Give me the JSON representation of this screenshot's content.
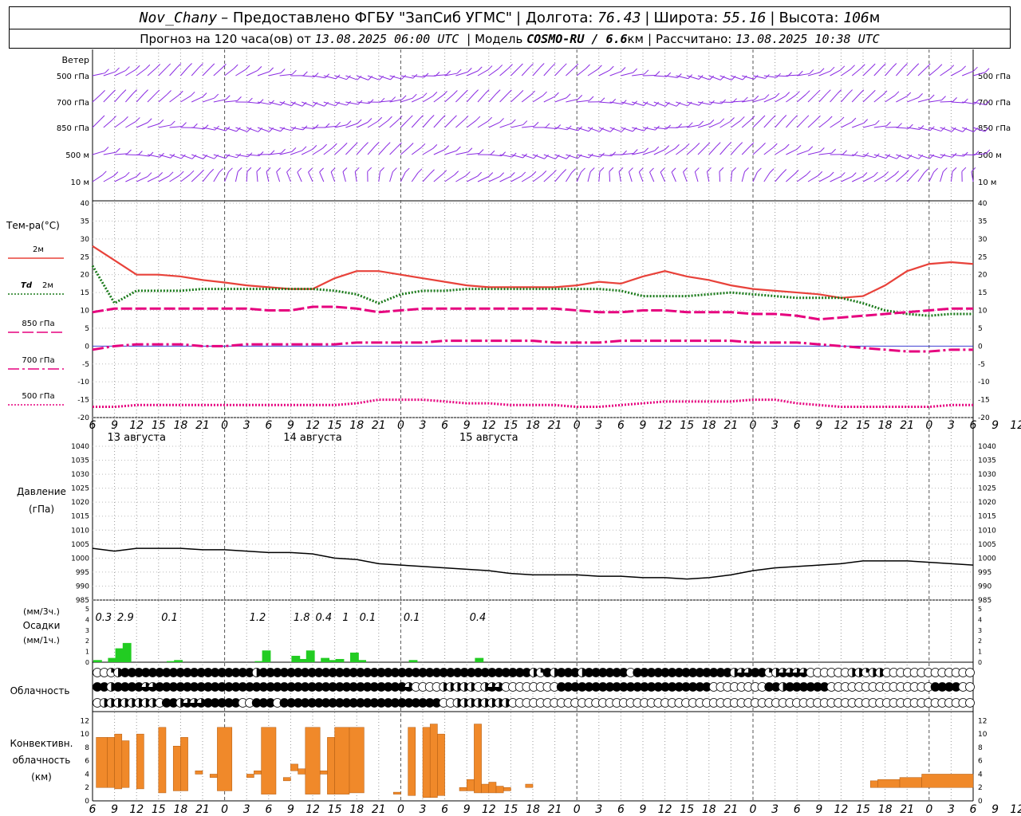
{
  "header": {
    "line1": {
      "station": "Nov_Chany",
      "provider": "– Предоставлено ФГБУ \"ЗапСиб УГМС\"",
      "lon_label": "Долгота:",
      "lon": "76.43",
      "lat_label": "Широта:",
      "lat": "55.16",
      "alt_label": "Высота:",
      "alt": "106",
      "alt_unit": "м"
    },
    "line2": {
      "forecast_label": "Прогноз на 120 часа(ов) от",
      "forecast_time": "13.08.2025 06:00 UTC",
      "model_label": "Модель",
      "model": "COSMO-RU / 6.6",
      "model_unit": "км",
      "calc_label": "Рассчитано:",
      "calc_time": "13.08.2025 10:38 UTC"
    }
  },
  "chart_data": [
    {
      "type": "wind_barbs",
      "panel_title": "Ветер",
      "levels": [
        "500 гПа",
        "700 гПа",
        "850 гПа",
        "500 м",
        "10 м"
      ],
      "color": "#8a2be2"
    },
    {
      "type": "line",
      "panel_title": "Тем-ра(°C)",
      "x_hours": [
        0,
        3,
        6,
        9,
        12,
        15,
        18,
        21,
        24,
        27,
        30,
        33,
        36,
        39,
        42,
        45,
        48,
        51,
        54,
        57,
        60,
        63,
        66,
        69,
        72,
        75,
        78,
        81,
        84,
        87,
        90,
        93,
        96,
        99,
        102,
        105,
        108,
        111,
        114,
        117,
        120
      ],
      "ylim": [
        -20,
        40
      ],
      "yticks": [
        -20,
        -15,
        -10,
        -5,
        0,
        5,
        10,
        15,
        20,
        25,
        30,
        35,
        40
      ],
      "series": [
        {
          "name": "2м",
          "color": "#e8423a",
          "style": "solid",
          "values": [
            28,
            24,
            20,
            20,
            19.5,
            18.5,
            17.8,
            17,
            16.5,
            16,
            16,
            19,
            21,
            21,
            20,
            19,
            18,
            17,
            16.5,
            16.5,
            16.5,
            16.5,
            17,
            18,
            17.5,
            19.5,
            21,
            19.5,
            18.5,
            17,
            16,
            15.5,
            15,
            14.5,
            13.5,
            14,
            17,
            21,
            23,
            23.5,
            23
          ]
        },
        {
          "name": "Td  2м",
          "color": "#1a7a1a",
          "style": "dotted",
          "values": [
            22.5,
            12,
            15.5,
            15.5,
            15.5,
            16,
            16,
            16,
            16,
            16,
            16,
            15.5,
            14.5,
            12,
            14.5,
            15.5,
            15.5,
            16,
            16,
            16,
            16,
            16,
            16,
            16,
            15.5,
            14,
            14,
            14,
            14.5,
            15,
            14.5,
            14,
            13.5,
            13.5,
            13.5,
            12,
            10,
            9,
            8.5,
            9,
            9
          ]
        },
        {
          "name": "850 гПа",
          "color": "#e6007e",
          "style": "dashed",
          "values": [
            9.5,
            10.5,
            10.5,
            10.5,
            10.5,
            10.5,
            10.5,
            10.5,
            10,
            10,
            11,
            11,
            10.5,
            9.5,
            10,
            10.5,
            10.5,
            10.5,
            10.5,
            10.5,
            10.5,
            10.5,
            10,
            9.5,
            9.5,
            10,
            10,
            9.5,
            9.5,
            9.5,
            9,
            9,
            8.5,
            7.5,
            8,
            8.5,
            9,
            9.5,
            10,
            10.5,
            10.5
          ]
        },
        {
          "name": "700 гПа",
          "color": "#e6007e",
          "style": "dashdot",
          "values": [
            -1,
            0,
            0.5,
            0.5,
            0.5,
            0,
            0,
            0.5,
            0.5,
            0.5,
            0.5,
            0.5,
            1,
            1,
            1,
            1,
            1.5,
            1.5,
            1.5,
            1.5,
            1.5,
            1,
            1,
            1,
            1.5,
            1.5,
            1.5,
            1.5,
            1.5,
            1.5,
            1,
            1,
            1,
            0.5,
            0,
            -0.5,
            -1,
            -1.5,
            -1.5,
            -1,
            -1
          ]
        },
        {
          "name": "500 гПа",
          "color": "#e6007e",
          "style": "dotted",
          "values": [
            -17,
            -17,
            -16.5,
            -16.5,
            -16.5,
            -16.5,
            -16.5,
            -16.5,
            -16.5,
            -16.5,
            -16.5,
            -16.5,
            -16,
            -15,
            -15,
            -15,
            -15.5,
            -16,
            -16,
            -16.5,
            -16.5,
            -16.5,
            -17,
            -17,
            -16.5,
            -16,
            -15.5,
            -15.5,
            -15.5,
            -15.5,
            -15,
            -15,
            -16,
            -16.5,
            -17,
            -17,
            -17,
            -17,
            -17,
            -16.5,
            -16.5
          ]
        }
      ]
    },
    {
      "type": "line",
      "panel_title": "Давление",
      "panel_unit": "(гПа)",
      "color": "#000000",
      "x_hours": [
        0,
        3,
        6,
        9,
        12,
        15,
        18,
        21,
        24,
        27,
        30,
        33,
        36,
        39,
        42,
        45,
        48,
        51,
        54,
        57,
        60,
        63,
        66,
        69,
        72,
        75,
        78,
        81,
        84,
        87,
        90,
        93,
        96,
        99,
        102,
        105,
        108,
        111,
        114,
        117,
        120
      ],
      "ylim": [
        985,
        1040
      ],
      "yticks": [
        985,
        990,
        995,
        1000,
        1005,
        1010,
        1015,
        1020,
        1025,
        1030,
        1035,
        1040
      ],
      "values": [
        1003.5,
        1002.5,
        1003.5,
        1003.5,
        1003.5,
        1003,
        1003,
        1002.5,
        1002,
        1002,
        1001.5,
        1000,
        999.5,
        998,
        997.5,
        997,
        996.5,
        996,
        995.5,
        994.5,
        994,
        994,
        994,
        993.5,
        993.5,
        993,
        993,
        992.5,
        993,
        994,
        995.5,
        996.5,
        997,
        997.5,
        998,
        999,
        999,
        999,
        998.5,
        998,
        997.5
      ]
    },
    {
      "type": "bar",
      "panel_title": "Осадки",
      "panel_unit_3h": "(мм/3ч.)",
      "panel_unit_1h": "(мм/1ч.)",
      "color": "#22cc22",
      "ylim": [
        0,
        5
      ],
      "yticks": [
        0,
        1,
        2,
        3,
        4,
        5
      ],
      "hourly": [
        {
          "h": 0,
          "v": 0.2
        },
        {
          "h": 2,
          "v": 0.4
        },
        {
          "h": 3,
          "v": 1.3
        },
        {
          "h": 4,
          "v": 1.8
        },
        {
          "h": 10,
          "v": 0.1
        },
        {
          "h": 11,
          "v": 0.2
        },
        {
          "h": 22,
          "v": 0.1
        },
        {
          "h": 23,
          "v": 1.1
        },
        {
          "h": 27,
          "v": 0.6
        },
        {
          "h": 28,
          "v": 0.3
        },
        {
          "h": 29,
          "v": 1.1
        },
        {
          "h": 31,
          "v": 0.4
        },
        {
          "h": 32,
          "v": 0.2
        },
        {
          "h": 33,
          "v": 0.3
        },
        {
          "h": 35,
          "v": 0.9
        },
        {
          "h": 36,
          "v": 0.2
        },
        {
          "h": 43,
          "v": 0.2
        },
        {
          "h": 52,
          "v": 0.4
        }
      ],
      "sums_3h": [
        {
          "h": 1.5,
          "label": "0.3"
        },
        {
          "h": 4.5,
          "label": "2.9"
        },
        {
          "h": 10.5,
          "label": "0.1"
        },
        {
          "h": 22.5,
          "label": "1.2"
        },
        {
          "h": 28.5,
          "label": "1.8"
        },
        {
          "h": 31.5,
          "label": "0.4"
        },
        {
          "h": 34.5,
          "label": "1"
        },
        {
          "h": 37.5,
          "label": "0.1"
        },
        {
          "h": 43.5,
          "label": "0.1"
        },
        {
          "h": 52.5,
          "label": "0.4"
        }
      ]
    },
    {
      "type": "symbols",
      "panel_title": "Облачность",
      "rows": [
        "0012444444444444444444424444444444444444444444444444444444444442142444244444404444444444444423344123333000000221220000000000000",
        "4424444334444444444444444444444444444444444443000022222023300000000444444444444444444444400000000442444444000000000000000444400",
        "0222222220442333444440044404444444444444444444444400222222220000000000000000000000000000000000000000000000000000000000000000000"
      ]
    },
    {
      "type": "bar",
      "panel_title": "Конвективн. облачность (км)",
      "color": "#f0892a",
      "ylim": [
        0,
        13
      ],
      "yticks": [
        0,
        2,
        4,
        6,
        8,
        10,
        12
      ],
      "bars": [
        {
          "h0": 0.5,
          "h1": 2,
          "base": 2,
          "top": 9.5
        },
        {
          "h0": 2,
          "h1": 3,
          "base": 2,
          "top": 9.5
        },
        {
          "h0": 3,
          "h1": 4,
          "base": 1.8,
          "top": 10
        },
        {
          "h0": 4,
          "h1": 5,
          "base": 2,
          "top": 9
        },
        {
          "h0": 6,
          "h1": 7,
          "base": 1.8,
          "top": 10
        },
        {
          "h0": 9,
          "h1": 10,
          "base": 1.2,
          "top": 11
        },
        {
          "h0": 11,
          "h1": 12,
          "base": 1.5,
          "top": 8.2
        },
        {
          "h0": 12,
          "h1": 13,
          "base": 1.5,
          "top": 9.5
        },
        {
          "h0": 14,
          "h1": 15,
          "base": 4,
          "top": 4.5
        },
        {
          "h0": 16,
          "h1": 17,
          "base": 3.5,
          "top": 4
        },
        {
          "h0": 17,
          "h1": 19,
          "base": 1.5,
          "top": 11
        },
        {
          "h0": 21,
          "h1": 22,
          "base": 3.5,
          "top": 4
        },
        {
          "h0": 22,
          "h1": 23,
          "base": 4,
          "top": 4.5
        },
        {
          "h0": 23,
          "h1": 25,
          "base": 1,
          "top": 11
        },
        {
          "h0": 26,
          "h1": 27,
          "base": 3,
          "top": 3.5
        },
        {
          "h0": 27,
          "h1": 28,
          "base": 4.5,
          "top": 5.5
        },
        {
          "h0": 28,
          "h1": 29,
          "base": 4,
          "top": 4.8
        },
        {
          "h0": 29,
          "h1": 31,
          "base": 1,
          "top": 11
        },
        {
          "h0": 31,
          "h1": 32,
          "base": 4,
          "top": 4.5
        },
        {
          "h0": 32,
          "h1": 33,
          "base": 1,
          "top": 9.5
        },
        {
          "h0": 33,
          "h1": 35,
          "base": 1,
          "top": 11
        },
        {
          "h0": 35,
          "h1": 37,
          "base": 1.2,
          "top": 11
        },
        {
          "h0": 41,
          "h1": 42,
          "base": 1,
          "top": 1.3
        },
        {
          "h0": 43,
          "h1": 44,
          "base": 0.8,
          "top": 11
        },
        {
          "h0": 45,
          "h1": 46,
          "base": 0.5,
          "top": 11
        },
        {
          "h0": 46,
          "h1": 47,
          "base": 0.5,
          "top": 11.5
        },
        {
          "h0": 47,
          "h1": 48,
          "base": 0.8,
          "top": 10
        },
        {
          "h0": 50,
          "h1": 51,
          "base": 1.5,
          "top": 2
        },
        {
          "h0": 51,
          "h1": 52,
          "base": 1.5,
          "top": 3.2
        },
        {
          "h0": 52,
          "h1": 53,
          "base": 1.2,
          "top": 11.5
        },
        {
          "h0": 53,
          "h1": 54,
          "base": 1.2,
          "top": 2.5
        },
        {
          "h0": 54,
          "h1": 55,
          "base": 1.2,
          "top": 2.8
        },
        {
          "h0": 55,
          "h1": 56,
          "base": 1.2,
          "top": 2.2
        },
        {
          "h0": 56,
          "h1": 57,
          "base": 1.5,
          "top": 2
        },
        {
          "h0": 59,
          "h1": 60,
          "base": 2,
          "top": 2.5
        },
        {
          "h0": 106,
          "h1": 107,
          "base": 2,
          "top": 3
        },
        {
          "h0": 107,
          "h1": 110,
          "base": 2,
          "top": 3.2
        },
        {
          "h0": 110,
          "h1": 113,
          "base": 2,
          "top": 3.5
        },
        {
          "h0": 113,
          "h1": 120,
          "base": 2,
          "top": 4
        }
      ]
    }
  ],
  "x_axis": {
    "hour_labels": [
      "6",
      "9",
      "12",
      "15",
      "18",
      "21",
      "0",
      "3",
      "6",
      "9",
      "12",
      "15",
      "18",
      "21",
      "0",
      "3",
      "6",
      "9",
      "12",
      "15",
      "18",
      "21",
      "0",
      "3",
      "6",
      "9",
      "12",
      "15",
      "18",
      "21",
      "0",
      "3",
      "6",
      "9",
      "12",
      "15",
      "18",
      "21",
      "0",
      "3",
      "6",
      "9",
      "12"
    ],
    "days": [
      {
        "h": 6,
        "label": "13 августа"
      },
      {
        "h": 30,
        "label": "14 августа"
      },
      {
        "h": 54,
        "label": "15 августа"
      }
    ]
  },
  "legend_labels": {
    "t2m": "2м",
    "td": "Td",
    "td2": "2м",
    "t850": "850 гПа",
    "t700": "700 гПа",
    "t500": "500 гПа"
  },
  "precip_labels": {
    "unit3": "(мм/3ч.)",
    "title": "Осадки",
    "unit1": "(мм/1ч.)"
  },
  "conv_labels": {
    "l1": "Конвективн.",
    "l2": "облачность",
    "l3": "(км)"
  }
}
